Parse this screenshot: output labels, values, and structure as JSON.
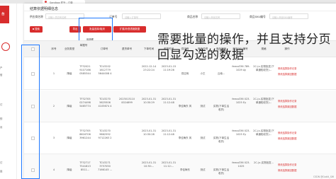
{
  "browser": {
    "tab_title": "Sandbox 时光 - 订单"
  },
  "sidebar": {
    "logo": "台",
    "labels": [
      "户",
      "信",
      "订",
      "的",
      "月",
      "订",
      "运"
    ]
  },
  "dialog": {
    "title": "结算依据明细信息",
    "filters": [
      {
        "label": "供应商名称",
        "placeholder": "请输入供应商名称"
      },
      {
        "label": "订单号",
        "placeholder": "请输入订单号"
      },
      {
        "label": "商品名称",
        "placeholder": "请输入商品名称"
      },
      {
        "label": "商品SKU编号",
        "placeholder": "请输入商品SKU编号"
      }
    ],
    "buttons": {
      "search": "搜索",
      "export": "导出",
      "batch_select": "批量选择/取消",
      "expand_all": "扩展/折叠表格数据"
    },
    "tooltip": "勾选框",
    "overlay": [
      "需要批量的操作，并且支持分页",
      "回显勾选的数据"
    ],
    "columns": [
      "序号",
      "业务类型",
      "单据号",
      "订单号",
      "退货单号",
      "下单时间",
      "收货时间",
      "供应商",
      "商品名称",
      "商品编号",
      "商品SKU编号",
      "规格",
      "操作"
    ],
    "rows": [
      {
        "index": "1",
        "type": "降级",
        "doc": "TF32021 9107166 0585344",
        "order": "TCU3202 1612779 5644008 4",
        "return": "",
        "order_time": "2022-12-14 23:22:24",
        "recv_time": "2023-01-15 11:19:26",
        "supplier": "供应商",
        "product": "小王",
        "product_no": "云南...",
        "sku": "feeco336 789-1029 Ay",
        "spec": "2C-(x-实物批发(下单通知收货)...",
        "ops": [
          "修改结算操作记录",
          "修改结算原因数据"
        ]
      },
      {
        "index": "2",
        "type": "降级",
        "doc": "TF32705 0274498 5465774",
        "order": "TCU3270 5625506 4105674 4",
        "return": "2023013110 0024699",
        "order_time": "2023-01-31 10:30:29",
        "recv_time": "2023-01-31 11:12:48",
        "supplier": "李佳梅东 风",
        "product": "测试",
        "product_no": "实物(下单生活收货)",
        "sku": "feeco336 023-1025 Ey",
        "spec": "2C-(x-实物批发(下单通知收货)...",
        "ops": [
          "修改结算操作记录",
          "修改结算原因数据"
        ]
      },
      {
        "index": "3",
        "type": "降级",
        "doc": "TF32705 8616706 3961244",
        "order": "TCU3270 9662592 9712263 2",
        "return": "",
        "order_time": "2023-01-31 10:30:28",
        "recv_time": "2023-01-31 11:12:48",
        "supplier": "李佳梅东 风",
        "product": "测试",
        "product_no": "实物(下单生活收货)",
        "sku": "feeco336 023-1025 Ey",
        "spec": "2C-(x-实物批发(下单通知收货)...",
        "ops": [
          "修改结算操作记录",
          "修改结算原因数据"
        ]
      },
      {
        "index": "4",
        "type": "降级",
        "doc": "TF32717 7541813 8511...",
        "order": "TCU3271 3757050 7166145 ...",
        "return": "",
        "order_time": "2023-01-31 10:30:...",
        "recv_time": "2023-01-31 11:12:...",
        "supplier": "李佳梅东",
        "product": "测试",
        "product_no": "实物(下单生活收货)",
        "sku": "feeco336 023-1025",
        "spec": "2C-(x-实物批发...",
        "ops": [
          "修改结算操作记录",
          "修改结算原因数据"
        ]
      }
    ]
  },
  "watermark": "CSDN @Gakiii_SW"
}
